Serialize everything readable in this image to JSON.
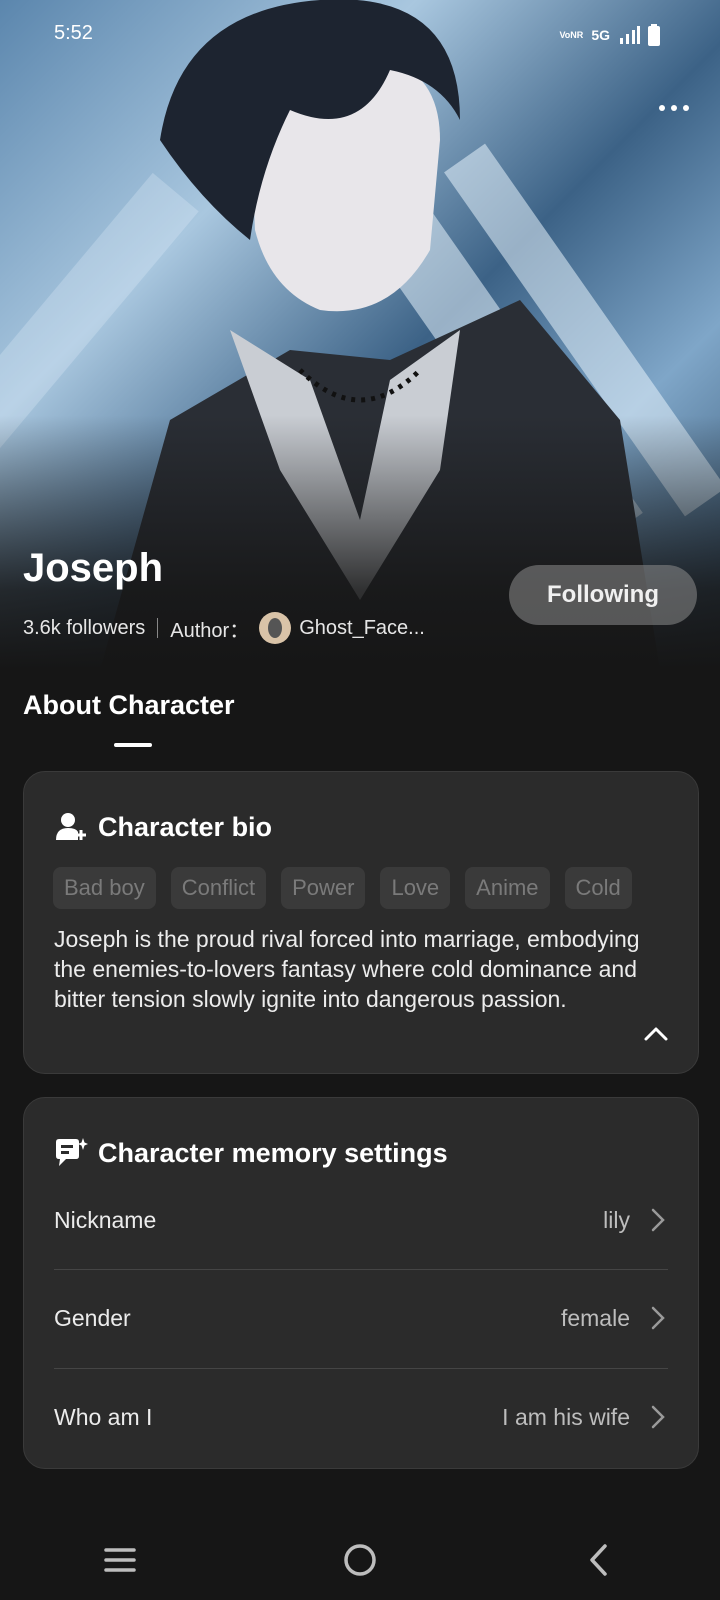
{
  "status_bar": {
    "time": "5:52",
    "network": "5G",
    "volte": "VoNR"
  },
  "header": {
    "more_icon": "more-dots-icon"
  },
  "character": {
    "name": "Joseph",
    "followers": "3.6k followers",
    "author_label": "Author：",
    "author_name": "Ghost_Face...",
    "follow_button": "Following"
  },
  "section": {
    "title": "About Character"
  },
  "bio": {
    "title": "Character bio",
    "icon": "person-plus-icon",
    "tags": [
      "Bad boy",
      "Conflict",
      "Power",
      "Love",
      "Anime",
      "Cold"
    ],
    "text": "Joseph is the proud rival forced into marriage, embodying the enemies-to-lovers fantasy where cold dominance and bitter tension slowly ignite into dangerous passion."
  },
  "memory": {
    "title": "Character memory settings",
    "icon": "chat-sparkle-icon",
    "rows": [
      {
        "label": "Nickname",
        "value": "lily"
      },
      {
        "label": "Gender",
        "value": "female"
      },
      {
        "label": "Who am I",
        "value": "I am his wife"
      }
    ]
  },
  "colors": {
    "background": "#161616",
    "card": "#2b2b2b",
    "tag_text": "#7a7a7a"
  }
}
